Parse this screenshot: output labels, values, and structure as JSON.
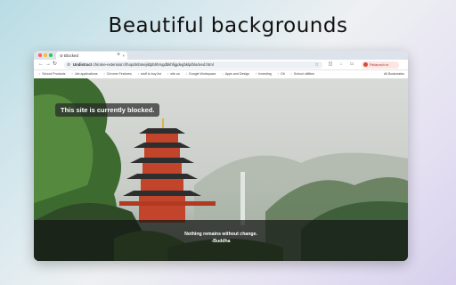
{
  "headline": "Beautiful backgrounds",
  "browser": {
    "tab_title": "⊘ Blocked",
    "tab_close": "×",
    "new_tab": "+",
    "nav_back": "←",
    "nav_forward": "→",
    "nav_reload": "↻",
    "url_app": "Undistract",
    "url": "chrome-extension://hopdmbmejildpbhhmgdbkhfijgdegbklp/blocked.html",
    "profile_label": "Relaunch to update",
    "bookmarks": [
      "School Products",
      "Job applications",
      "Chrome Features",
      "stuff to buy list",
      "site.ca",
      "Google Workspace",
      "Apps and Design",
      "Investing",
      "Git",
      "School utilities"
    ],
    "bookmarks_right": "All Bookmarks"
  },
  "page": {
    "blocked_message": "This site is currently blocked.",
    "quote": "Nothing remains without change.",
    "author": "-Buddha"
  },
  "colors": {
    "accent": "#d64b3b",
    "pagoda": "#c2442a",
    "overlay": "#141614"
  }
}
